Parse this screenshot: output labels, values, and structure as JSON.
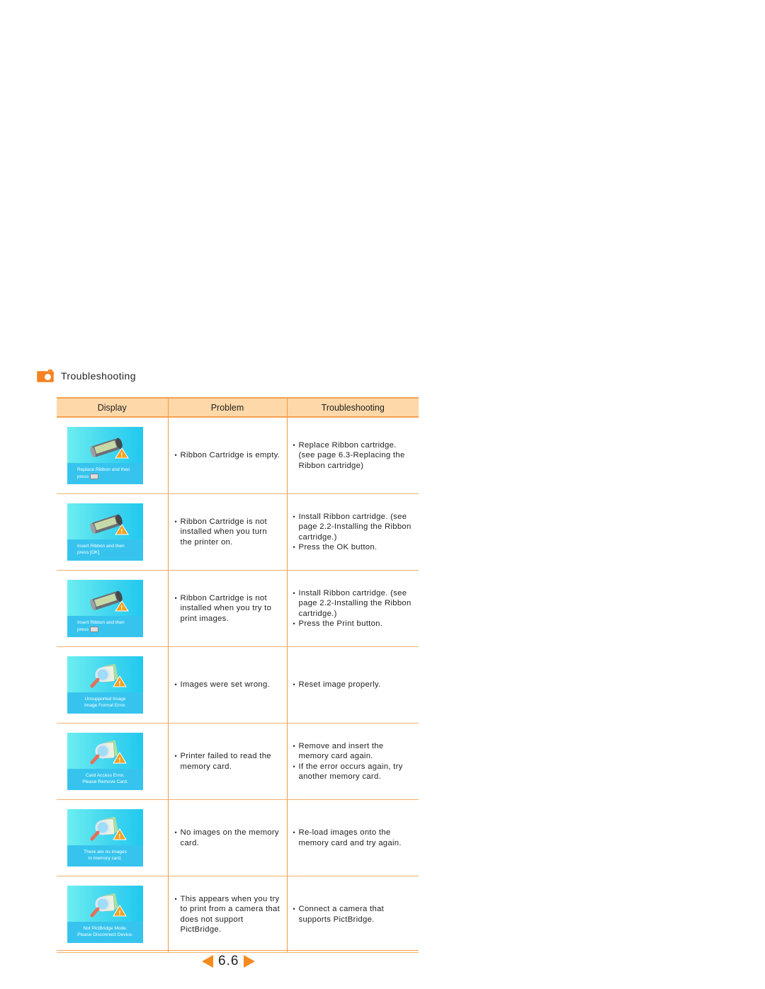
{
  "section": {
    "icon": "camera-icon",
    "title": "Troubleshooting"
  },
  "table": {
    "headers": [
      "Display",
      "Problem",
      "Troubleshooting"
    ],
    "rows": [
      {
        "display": {
          "icon": "ribbon-cartridge-warning-icon",
          "caption_lines": [
            "Replace Ribbon and then",
            "press"
          ],
          "caption_icon": "printer-button-icon"
        },
        "problem": [
          "Ribbon Cartridge is empty."
        ],
        "solution": [
          "Replace Ribbon cartridge. (see page 6.3-Replacing the Ribbon cartridge)"
        ]
      },
      {
        "display": {
          "icon": "ribbon-cartridge-warning-icon",
          "caption_lines": [
            "Insert Ribbon and then",
            "press [OK]"
          ]
        },
        "problem": [
          "Ribbon Cartridge is not installed when you turn the printer on."
        ],
        "solution": [
          "Install Ribbon cartridge. (see page 2.2-Installing the Ribbon cartridge.)",
          "Press the OK button."
        ]
      },
      {
        "display": {
          "icon": "ribbon-cartridge-warning-icon",
          "caption_lines": [
            "Insert Ribbon and then",
            "press"
          ],
          "caption_icon": "printer-button-icon"
        },
        "problem": [
          "Ribbon Cartridge is not installed when you try to print images."
        ],
        "solution": [
          "Install Ribbon cartridge. (see page 2.2-Installing the Ribbon cartridge.)",
          "Press the Print button."
        ]
      },
      {
        "display": {
          "icon": "magnifier-photo-warning-icon",
          "caption_lines": [
            "Unsupported Image",
            "Image Format Error."
          ]
        },
        "problem": [
          "Images were set wrong."
        ],
        "solution": [
          "Reset image properly."
        ]
      },
      {
        "display": {
          "icon": "magnifier-photo-warning-icon",
          "caption_lines": [
            "Card Access Error.",
            "Please Remove Card."
          ]
        },
        "problem": [
          "Printer failed to read the memory card."
        ],
        "solution": [
          "Remove and insert the memory card again.",
          "If the error occurs again, try another memory card."
        ]
      },
      {
        "display": {
          "icon": "magnifier-photo-warning-icon",
          "caption_lines": [
            "There are no images",
            "in memory card."
          ]
        },
        "problem": [
          "No images on the memory card."
        ],
        "solution": [
          "Re-load images onto the memory card and try again."
        ]
      },
      {
        "display": {
          "icon": "magnifier-photo-warning-icon",
          "caption_lines": [
            "Not PictBridge Mode.",
            "Please Disconnect Device."
          ]
        },
        "problem": [
          "This appears when you try to print from a camera that does not support PictBridge."
        ],
        "solution": [
          "Connect a camera that supports PictBridge."
        ]
      }
    ]
  },
  "pager": {
    "page": "6.6",
    "prev_icon": "arrow-left-icon",
    "next_icon": "arrow-right-icon"
  },
  "colors": {
    "accent": "#f58220",
    "header_bg": "#fed8a8",
    "screen_blue": "#36c4ee"
  }
}
